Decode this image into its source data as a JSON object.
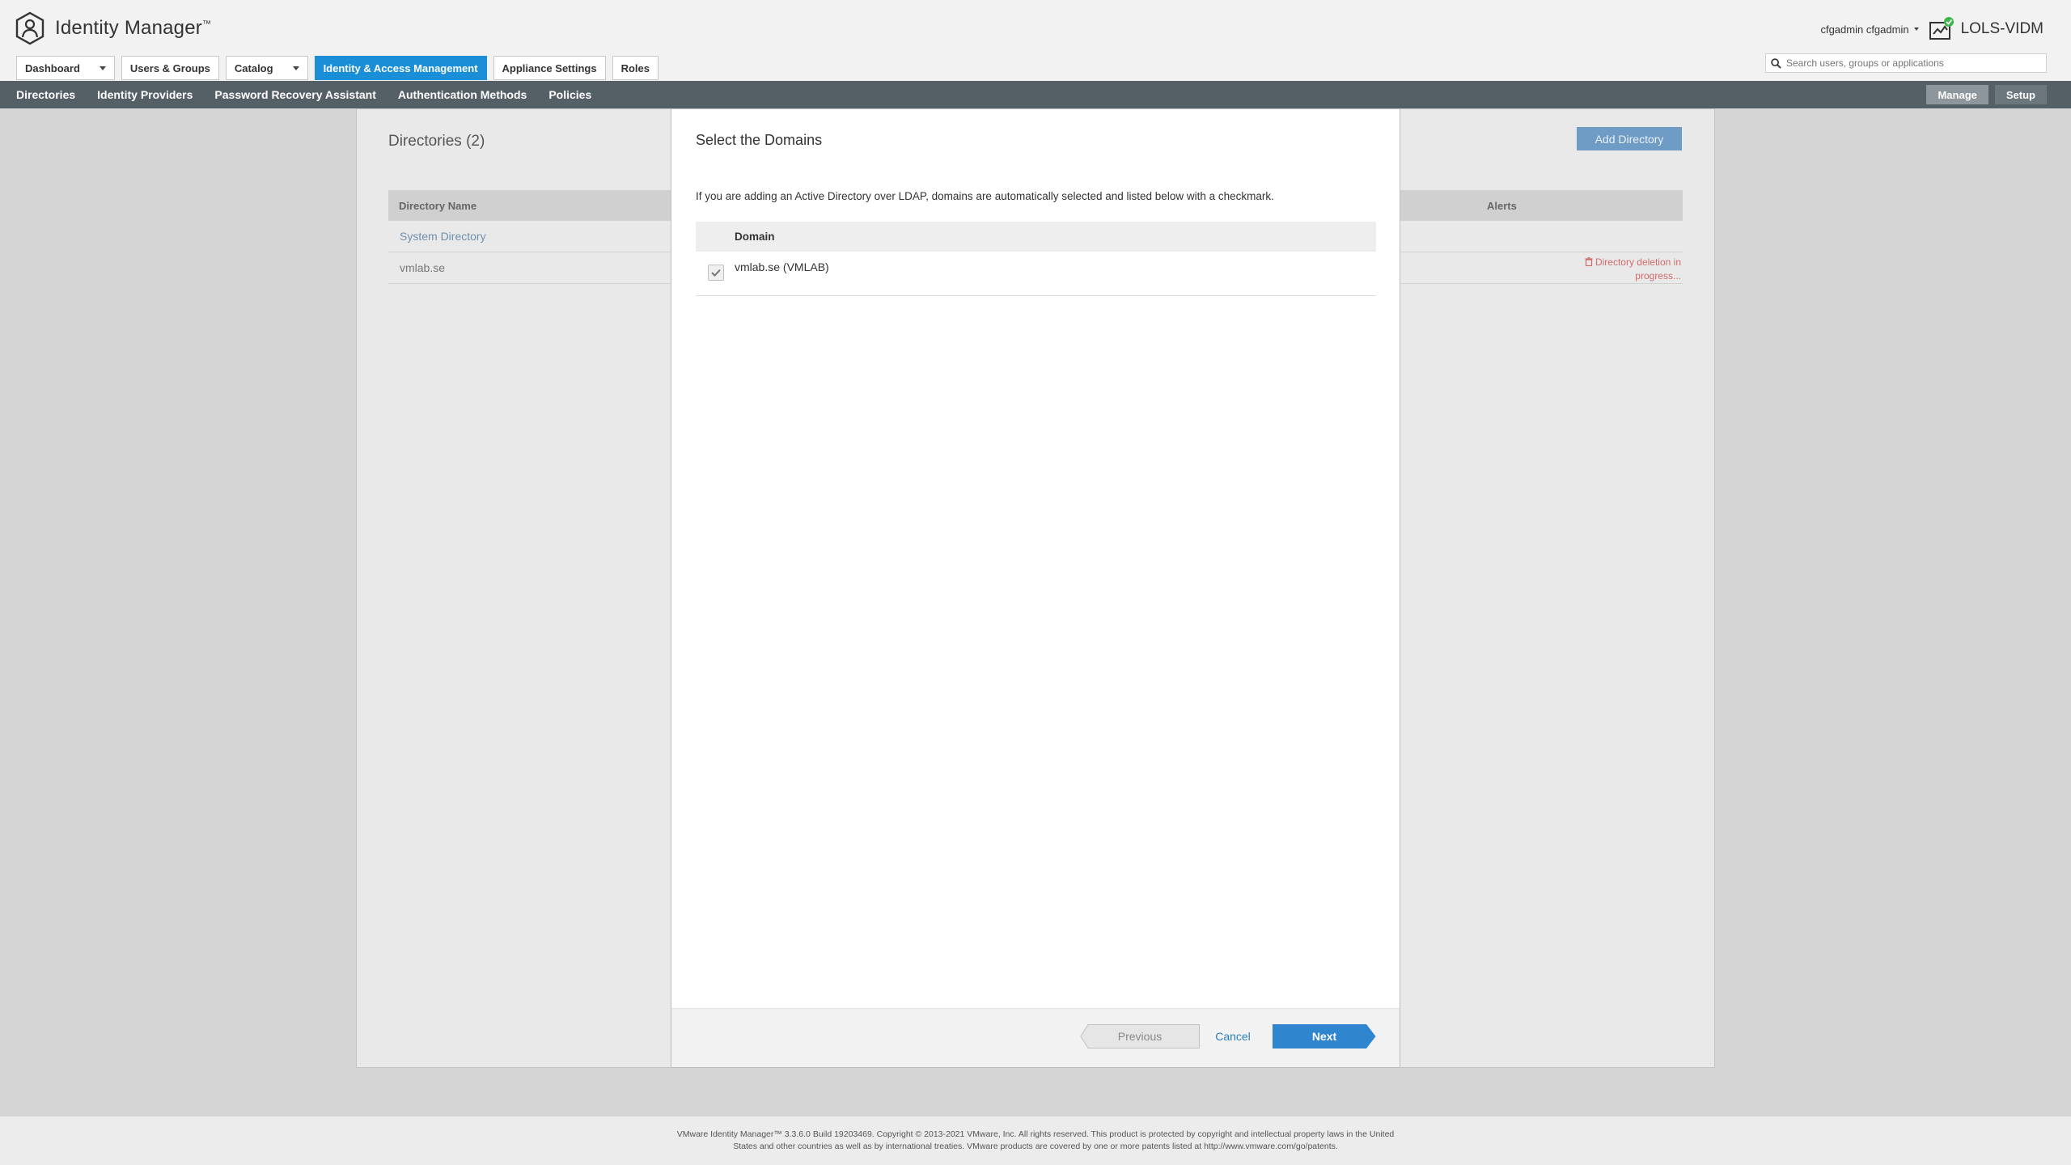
{
  "app": {
    "title": "Identity Manager",
    "trademark": "™"
  },
  "top_tabs": [
    {
      "label": "Dashboard",
      "dropdown": true,
      "active": false
    },
    {
      "label": "Users & Groups",
      "dropdown": false,
      "active": false
    },
    {
      "label": "Catalog",
      "dropdown": true,
      "active": false
    },
    {
      "label": "Identity & Access Management",
      "dropdown": false,
      "active": true
    },
    {
      "label": "Appliance Settings",
      "dropdown": false,
      "active": false
    },
    {
      "label": "Roles",
      "dropdown": false,
      "active": false
    }
  ],
  "user": {
    "name": "cfgadmin cfgadmin",
    "tenant": "LOLS-VIDM"
  },
  "search": {
    "placeholder": "Search users, groups or applications",
    "value": ""
  },
  "subnav": {
    "items": [
      "Directories",
      "Identity Providers",
      "Password Recovery Assistant",
      "Authentication Methods",
      "Policies"
    ],
    "manage_label": "Manage",
    "setup_label": "Setup"
  },
  "directories": {
    "title": "Directories (2)",
    "add_button": "Add Directory",
    "columns": {
      "name": "Directory Name",
      "alerts": "Alerts"
    },
    "rows": [
      {
        "name": "System Directory",
        "alert": ""
      },
      {
        "name": "vmlab.se",
        "alert": "Directory deletion in progress..."
      }
    ]
  },
  "modal": {
    "title": "Select the Domains",
    "description": "If you are adding an Active Directory over LDAP, domains are automatically selected and listed below with a checkmark.",
    "domain_header": "Domain",
    "domains": [
      {
        "name": "vmlab.se (VMLAB)",
        "checked": true
      }
    ],
    "previous_label": "Previous",
    "cancel_label": "Cancel",
    "next_label": "Next"
  },
  "footer": {
    "line1": "VMware Identity Manager™ 3.3.6.0 Build 19203469. Copyright © 2013-2021 VMware, Inc. All rights reserved. This product is protected by copyright and intellectual property laws in the United",
    "line2": "States and other countries as well as by international treaties. VMware products are covered by one or more patents listed at http://www.vmware.com/go/patents."
  },
  "colors": {
    "accent": "#1a8fd7",
    "subnav_bg": "#555f66",
    "next_button": "#2f86cf",
    "alert_red": "#d16a6a",
    "status_green": "#3cb54a"
  },
  "icons": [
    "app-logo-icon",
    "tenant-status-icon",
    "search-icon",
    "checkmark-icon",
    "trash-icon"
  ]
}
